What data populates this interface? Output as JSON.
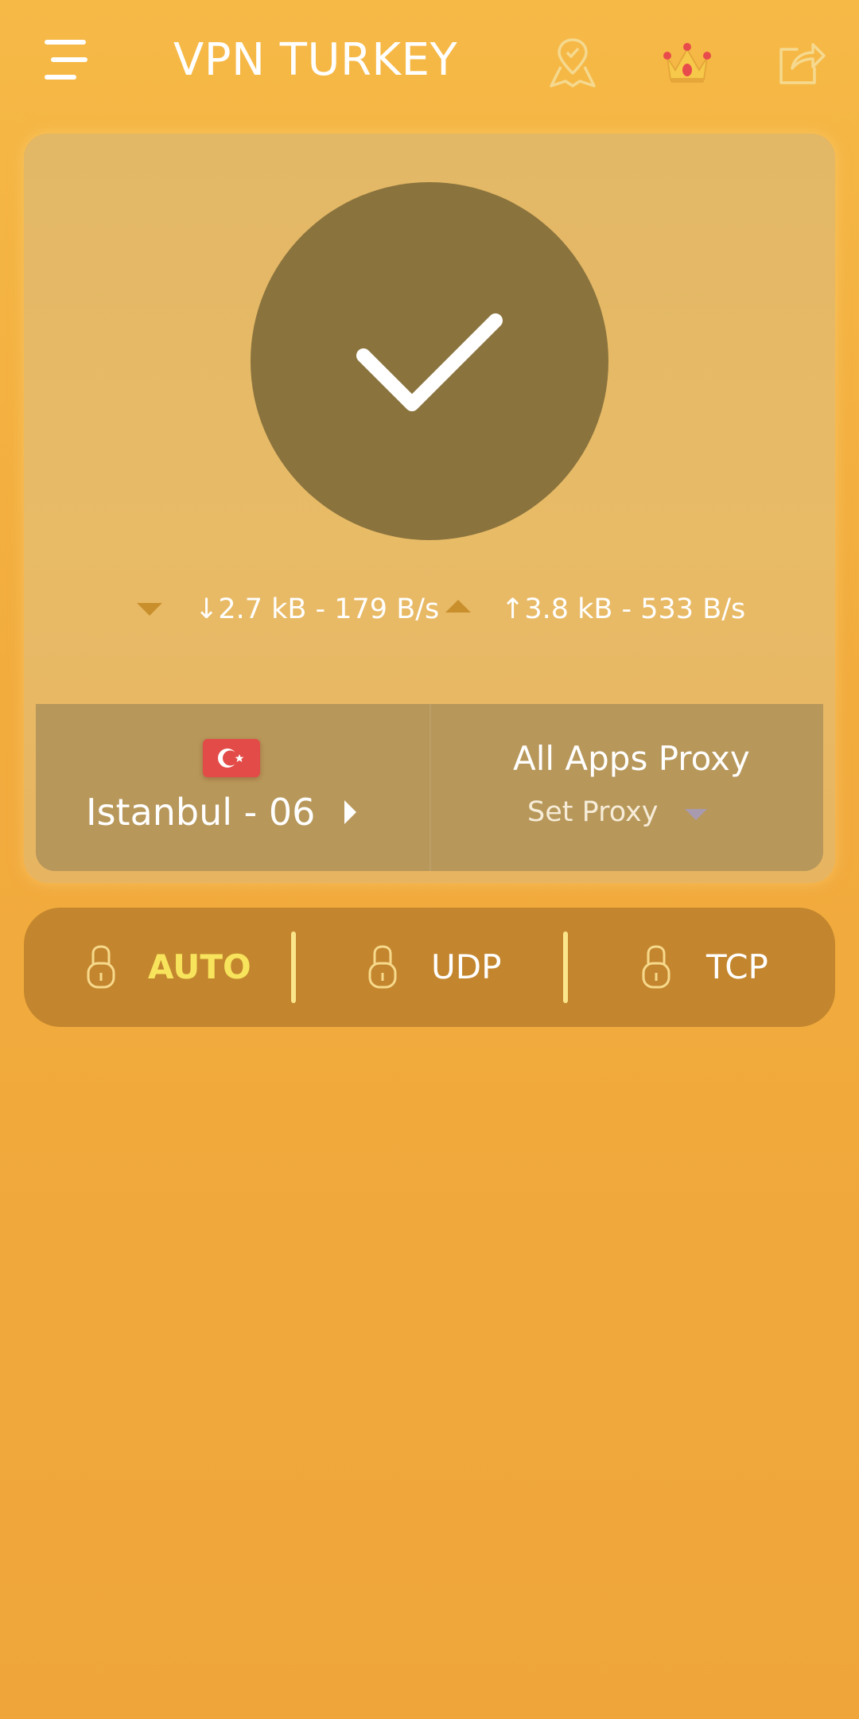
{
  "header": {
    "title": "VPN TURKEY",
    "icons": [
      "menu-icon",
      "map-pin-icon",
      "crown-icon",
      "share-icon"
    ]
  },
  "connection": {
    "status_icon": "checkmark-icon",
    "download_text": "↓2.7 kB - 179 B/s",
    "upload_text": "↑3.8 kB - 533 B/s"
  },
  "server": {
    "flag": "turkey-flag-icon",
    "name": "Istanbul - 06"
  },
  "proxy": {
    "title": "All Apps Proxy",
    "subtitle": "Set Proxy"
  },
  "protocols": [
    {
      "label": "AUTO",
      "active": true
    },
    {
      "label": "UDP",
      "active": false
    },
    {
      "label": "TCP",
      "active": false
    }
  ],
  "colors": {
    "background": "#f2ac3e",
    "card": "#e6b966",
    "connect_circle": "#8a733d",
    "server_panel": "#b7975a",
    "protocol_bar": "#c3862e",
    "active_protocol": "#f8e45c",
    "flag_red": "#e34b48"
  }
}
